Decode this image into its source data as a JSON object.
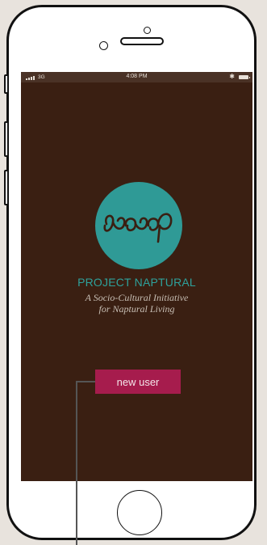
{
  "status_bar": {
    "network": "3G",
    "time": "4:08 PM",
    "bluetooth_icon": "bluetooth-icon",
    "battery_icon": "battery-icon"
  },
  "app": {
    "title": "PROJECT NAPTURAL",
    "tagline_line1": "A Socio-Cultural Initiative",
    "tagline_line2": "for Naptural Living",
    "new_user_label": "new user"
  },
  "colors": {
    "screen_bg": "#3a1f12",
    "logo_circle": "#2f9a96",
    "title_text": "#2ea19b",
    "button_bg": "#a61c4d"
  }
}
